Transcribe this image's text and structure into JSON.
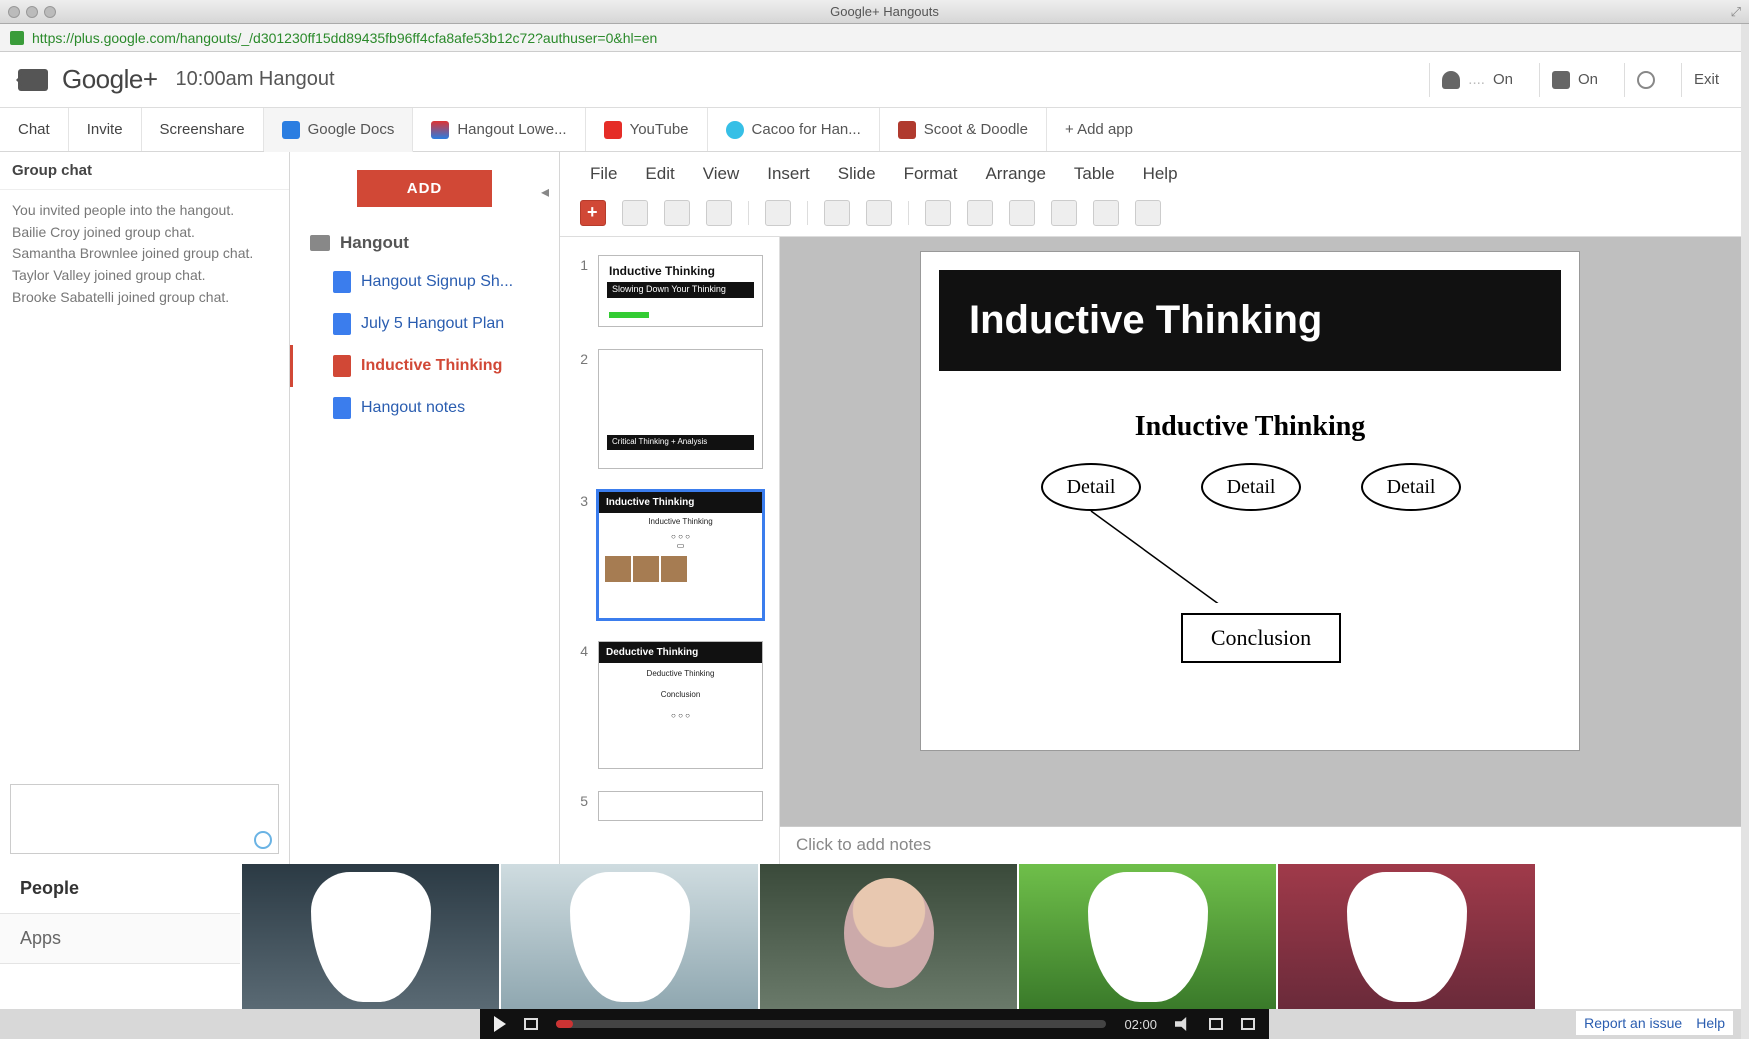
{
  "window": {
    "title": "Google+ Hangouts"
  },
  "url": "https://plus.google.com/hangouts/_/d301230ff15dd89435fb96ff4cfa8afe53b12c72?authuser=0&hl=en",
  "header": {
    "brand": "Google+",
    "hangout_name": "10:00am Hangout",
    "mic_label": "On",
    "cam_label": "On",
    "exit_label": "Exit"
  },
  "app_tabs": {
    "chat": "Chat",
    "invite": "Invite",
    "screenshare": "Screenshare",
    "gdocs": "Google Docs",
    "lower": "Hangout Lowe...",
    "youtube": "YouTube",
    "cacoo": "Cacoo for Han...",
    "scoot": "Scoot & Doodle",
    "add": "+ Add app"
  },
  "chat": {
    "header": "Group chat",
    "lines": [
      "You invited people into the hangout.",
      "Bailie Croy joined group chat.",
      "Samantha Brownlee joined group chat.",
      "Taylor Valley joined group chat.",
      "Brooke Sabatelli joined group chat."
    ]
  },
  "left_tabs": {
    "people": "People",
    "apps": "Apps"
  },
  "docs_sidebar": {
    "add": "ADD",
    "folder": "Hangout",
    "items": [
      {
        "label": "Hangout Signup Sh...",
        "type": "doc"
      },
      {
        "label": "July 5 Hangout Plan",
        "type": "doc"
      },
      {
        "label": "Inductive Thinking",
        "type": "slides"
      },
      {
        "label": "Hangout notes",
        "type": "doc"
      }
    ]
  },
  "menus": {
    "file": "File",
    "edit": "Edit",
    "view": "View",
    "insert": "Insert",
    "slide": "Slide",
    "format": "Format",
    "arrange": "Arrange",
    "table": "Table",
    "help": "Help"
  },
  "thumbs": {
    "n1": "1",
    "n2": "2",
    "n3": "3",
    "n4": "4",
    "n5": "5",
    "t1_title": "Inductive Thinking",
    "t1_sub": "Slowing Down Your Thinking",
    "t2_bar": "Critical Thinking + Analysis",
    "t3_bar": "Inductive Thinking",
    "t3_h": "Inductive Thinking",
    "t4_bar": "Deductive Thinking",
    "t4_h": "Deductive Thinking",
    "t4_c": "Conclusion"
  },
  "slide": {
    "title": "Inductive Thinking",
    "subtitle": "Inductive Thinking",
    "detail": "Detail",
    "conclusion": "Conclusion"
  },
  "notes_placeholder": "Click to add notes",
  "player": {
    "time": "02:00"
  },
  "footer": {
    "report": "Report an issue",
    "help": "Help"
  }
}
